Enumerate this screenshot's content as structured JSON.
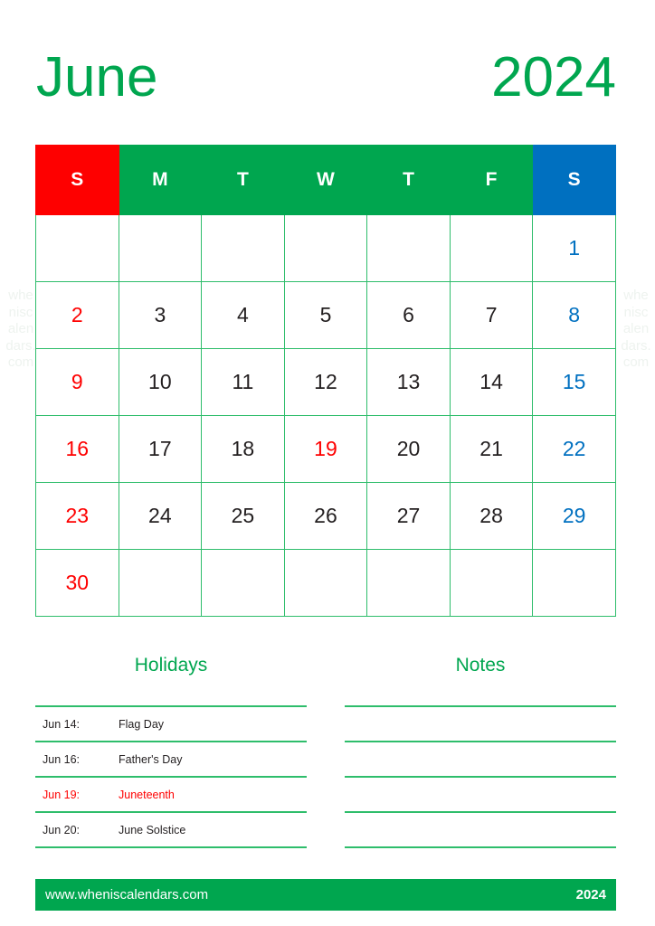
{
  "header": {
    "month": "June",
    "year": "2024"
  },
  "watermark": "wheniscalendars.com",
  "colors": {
    "green": "#00a64f",
    "grid_green": "#2ebd6b",
    "sunday_red": "#fe0000",
    "saturday_blue": "#0070c0",
    "text_dark": "#231f20"
  },
  "calendar": {
    "weekday_headers": [
      {
        "label": "S",
        "kind": "sunday"
      },
      {
        "label": "M",
        "kind": "weekday"
      },
      {
        "label": "T",
        "kind": "weekday"
      },
      {
        "label": "W",
        "kind": "weekday"
      },
      {
        "label": "T",
        "kind": "weekday"
      },
      {
        "label": "F",
        "kind": "weekday"
      },
      {
        "label": "S",
        "kind": "saturday"
      }
    ],
    "weeks": [
      [
        {
          "day": "",
          "kind": "empty"
        },
        {
          "day": "",
          "kind": "empty"
        },
        {
          "day": "",
          "kind": "empty"
        },
        {
          "day": "",
          "kind": "empty"
        },
        {
          "day": "",
          "kind": "empty"
        },
        {
          "day": "",
          "kind": "empty"
        },
        {
          "day": "1",
          "kind": "saturday"
        }
      ],
      [
        {
          "day": "2",
          "kind": "sunday"
        },
        {
          "day": "3",
          "kind": "weekday"
        },
        {
          "day": "4",
          "kind": "weekday"
        },
        {
          "day": "5",
          "kind": "weekday"
        },
        {
          "day": "6",
          "kind": "weekday"
        },
        {
          "day": "7",
          "kind": "weekday"
        },
        {
          "day": "8",
          "kind": "saturday"
        }
      ],
      [
        {
          "day": "9",
          "kind": "sunday"
        },
        {
          "day": "10",
          "kind": "weekday"
        },
        {
          "day": "11",
          "kind": "weekday"
        },
        {
          "day": "12",
          "kind": "weekday"
        },
        {
          "day": "13",
          "kind": "weekday"
        },
        {
          "day": "14",
          "kind": "weekday"
        },
        {
          "day": "15",
          "kind": "saturday"
        }
      ],
      [
        {
          "day": "16",
          "kind": "sunday"
        },
        {
          "day": "17",
          "kind": "weekday"
        },
        {
          "day": "18",
          "kind": "weekday"
        },
        {
          "day": "19",
          "kind": "holiday"
        },
        {
          "day": "20",
          "kind": "weekday"
        },
        {
          "day": "21",
          "kind": "weekday"
        },
        {
          "day": "22",
          "kind": "saturday"
        }
      ],
      [
        {
          "day": "23",
          "kind": "sunday"
        },
        {
          "day": "24",
          "kind": "weekday"
        },
        {
          "day": "25",
          "kind": "weekday"
        },
        {
          "day": "26",
          "kind": "weekday"
        },
        {
          "day": "27",
          "kind": "weekday"
        },
        {
          "day": "28",
          "kind": "weekday"
        },
        {
          "day": "29",
          "kind": "saturday"
        }
      ],
      [
        {
          "day": "30",
          "kind": "sunday"
        },
        {
          "day": "",
          "kind": "empty"
        },
        {
          "day": "",
          "kind": "empty"
        },
        {
          "day": "",
          "kind": "empty"
        },
        {
          "day": "",
          "kind": "empty"
        },
        {
          "day": "",
          "kind": "empty"
        },
        {
          "day": "",
          "kind": "empty"
        }
      ]
    ]
  },
  "holidays": {
    "title": "Holidays",
    "items": [
      {
        "date": "Jun 14:",
        "name": "Flag Day",
        "highlight": false
      },
      {
        "date": "Jun 16:",
        "name": "Father's Day",
        "highlight": false
      },
      {
        "date": "Jun 19:",
        "name": "Juneteenth",
        "highlight": true
      },
      {
        "date": "Jun 20:",
        "name": "June Solstice",
        "highlight": false
      }
    ]
  },
  "notes": {
    "title": "Notes",
    "line_count": 5
  },
  "footer": {
    "url": "www.wheniscalendars.com",
    "year": "2024"
  }
}
